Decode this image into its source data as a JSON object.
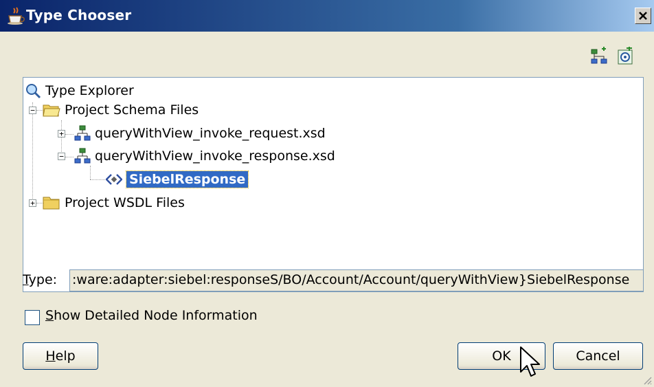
{
  "window": {
    "title": "Type Chooser",
    "icon": "java-cup-icon",
    "close_icon": "close-icon"
  },
  "toolbar": {
    "icons": [
      "schema-tree-icon",
      "import-wsdl-icon"
    ]
  },
  "tree": {
    "root": {
      "label": "Type Explorer",
      "icon": "magnifier-icon"
    },
    "project_schema_files": {
      "label": "Project Schema Files",
      "expanded": true,
      "icon": "open-folder-icon"
    },
    "request_xsd": {
      "label": "queryWithView_invoke_request.xsd",
      "expanded": false,
      "icon": "schema-icon"
    },
    "response_xsd": {
      "label": "queryWithView_invoke_response.xsd",
      "expanded": true,
      "icon": "schema-icon"
    },
    "siebel_response": {
      "label": "SiebelResponse",
      "selected": true,
      "icon": "element-icon"
    },
    "project_wsdl_files": {
      "label": "Project WSDL Files",
      "expanded": false,
      "icon": "closed-folder-icon"
    }
  },
  "type_field": {
    "label_first": "T",
    "label_rest": "ype:",
    "value": ":ware:adapter:siebel:responseS/BO/Account/Account/queryWithView}SiebelResponse"
  },
  "show_detailed": {
    "label_first": "S",
    "label_rest": "how Detailed Node Information",
    "checked": false
  },
  "buttons": {
    "help_first": "H",
    "help_rest": "elp",
    "ok": "OK",
    "cancel": "Cancel"
  },
  "colors": {
    "title_bar": "#0a246a",
    "selection": "#316ac5",
    "dialog_bg": "#ece9d8"
  }
}
